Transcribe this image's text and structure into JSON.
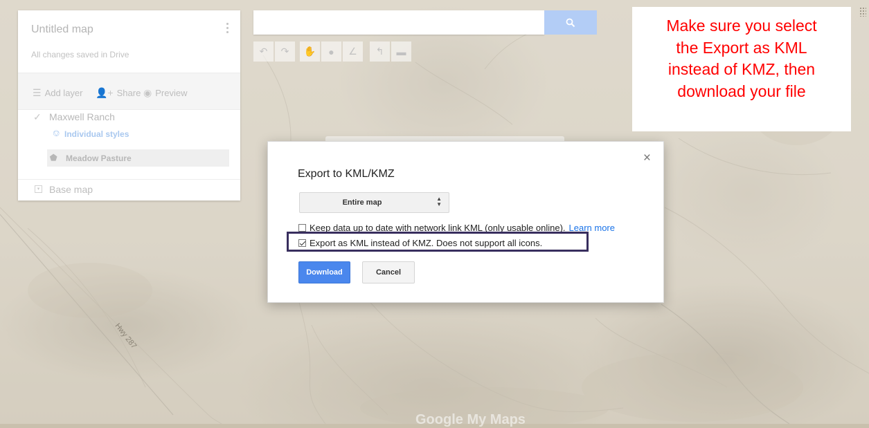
{
  "panel": {
    "title": "Untitled map",
    "saved_status": "All changes saved in Drive",
    "actions": {
      "add_layer": "Add layer",
      "share": "Share",
      "preview": "Preview"
    },
    "layer": {
      "name": "Maxwell Ranch",
      "styles_link": "Individual styles",
      "feature": "Meadow Pasture"
    },
    "base_map": "Base map"
  },
  "search": {
    "value": "",
    "placeholder": ""
  },
  "toolbar": {
    "items": [
      "undo-icon",
      "redo-icon",
      "hand-icon",
      "marker-icon",
      "draw-line-icon",
      "directions-icon",
      "ruler-icon"
    ]
  },
  "annotation": {
    "lines": [
      "Make sure you select",
      "the Export as KML",
      "instead of KMZ, then",
      "download your file"
    ],
    "color": "#ff0000"
  },
  "dialog": {
    "title": "Export to KML/KMZ",
    "close": "×",
    "select_value": "Entire map",
    "option_network": {
      "label": "Keep data up to date with network link KML (only usable online).",
      "checked": false,
      "link": "Learn more"
    },
    "option_kml": {
      "label": "Export as KML instead of KMZ. Does not support all icons.",
      "checked": true
    },
    "download_label": "Download",
    "cancel_label": "Cancel",
    "primary_color": "#4a87ed"
  },
  "map": {
    "road_label": "Hwy 287",
    "watermark": "Google My Maps"
  }
}
